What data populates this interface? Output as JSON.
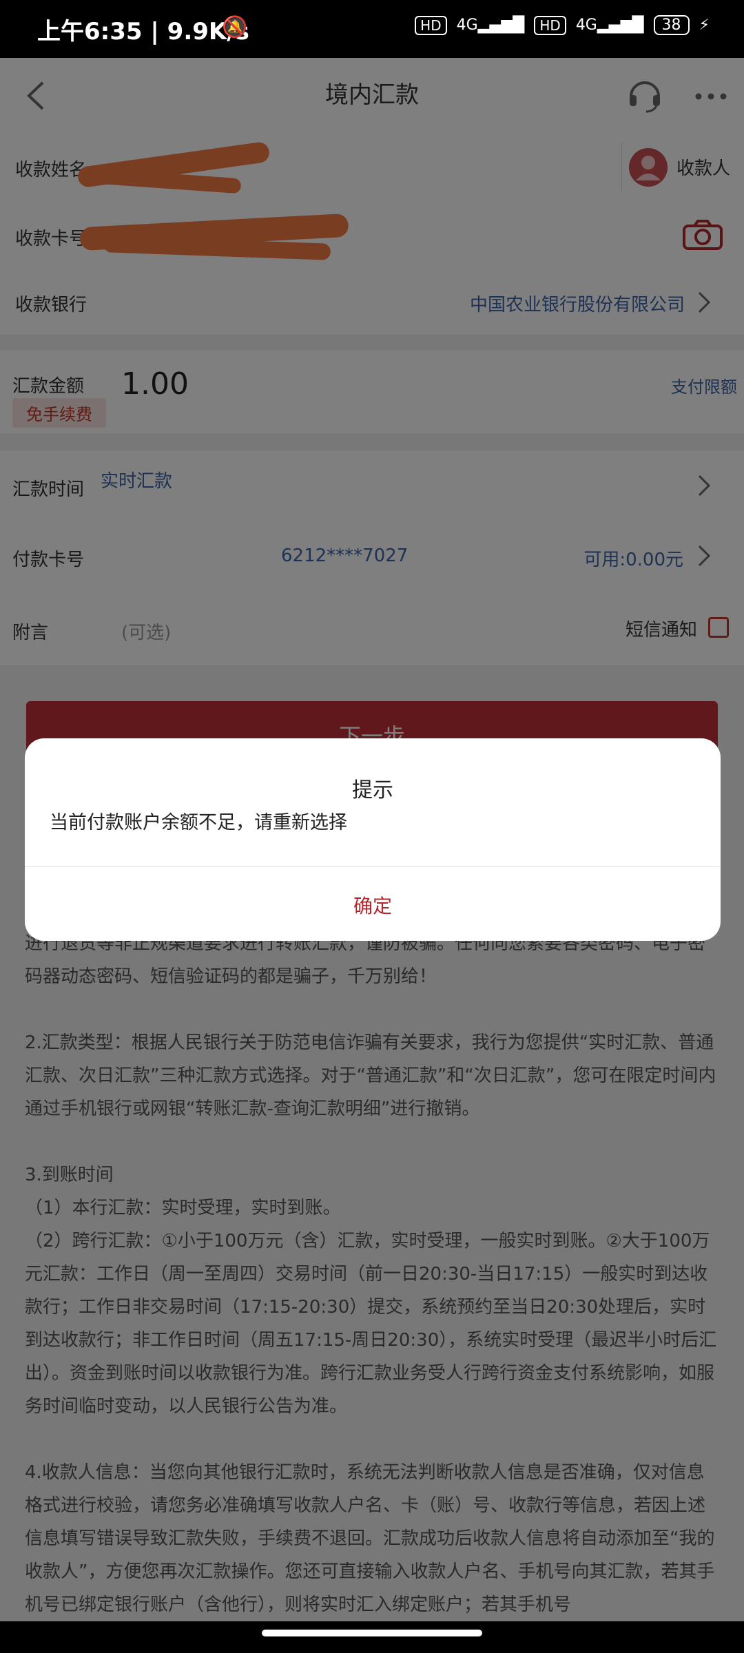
{
  "status_bar": {
    "time": "上午6:35 | 9.9K/s",
    "battery": "38"
  },
  "nav": {
    "title": "境内汇款"
  },
  "form": {
    "payee_name_label": "收款姓名",
    "payee_button": "收款人",
    "card_label": "收款卡号",
    "bank_label": "收款银行",
    "bank_value": "中国农业银行股份有限公司",
    "amount_label": "汇款金额",
    "amount_value": "1.00",
    "fee_badge": "免手续费",
    "limit_link": "支付限额",
    "time_label": "汇款时间",
    "time_value": "实时汇款",
    "pay_card_label": "付款卡号",
    "pay_card_value": "6212****7027",
    "available": "可用:0.00元",
    "note_label": "附言",
    "note_placeholder": "(可选)",
    "sms_label": "短信通知"
  },
  "next_button": "下一步",
  "dialog": {
    "title": "提示",
    "message": "当前付款账户余额不足，请重新选择",
    "confirm": "确定"
  },
  "notes": "进行退货等非正规渠道要求进行转账汇款，谨防被骗。任何向您索要各类密码、电子密码器动态密码、短信验证码的都是骗子，千万别给！\n\n2.汇款类型：根据人民银行关于防范电信诈骗有关要求，我行为您提供“实时汇款、普通汇款、次日汇款”三种汇款方式选择。对于“普通汇款”和“次日汇款”，您可在限定时间内通过手机银行或网银“转账汇款-查询汇款明细”进行撤销。\n\n3.到账时间\n（1）本行汇款：实时受理，实时到账。\n（2）跨行汇款：①小于100万元（含）汇款，实时受理，一般实时到账。②大于100万元汇款：工作日（周一至周四）交易时间（前一日20:30-当日17:15）一般实时到达收款行；工作日非交易时间（17:15-20:30）提交，系统预约至当日20:30处理后，实时到达收款行；非工作日时间（周五17:15-周日20:30），系统实时受理（最迟半小时后汇出）。资金到账时间以收款银行为准。跨行汇款业务受人行跨行资金支付系统影响，如服务时间临时变动，以人民银行公告为准。\n\n4.收款人信息：当您向其他银行汇款时，系统无法判断收款人信息是否准确，仅对信息格式进行校验，请您务必准确填写收款人户名、卡（账）号、收款行等信息，若因上述信息填写错误导致汇款失败，手续费不退回。汇款成功后收款人信息将自动添加至“我的收款人”，方便您再次汇款操作。您还可直接输入收款人户名、手机号向其汇款，若其手机号已绑定银行账户（含他行），则将实时汇入绑定账户；若其手机号"
}
